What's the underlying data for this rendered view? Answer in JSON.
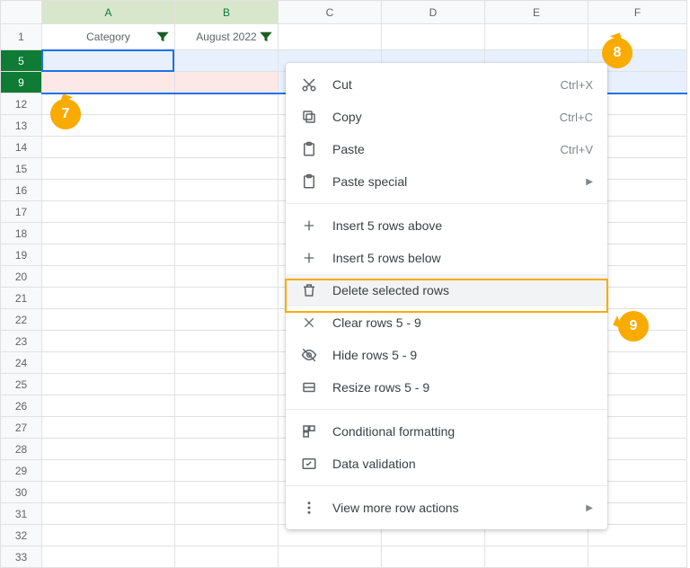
{
  "columns": [
    "A",
    "B",
    "C",
    "D",
    "E",
    "F"
  ],
  "row_headers": [
    "1",
    "5",
    "9",
    "12",
    "13",
    "14",
    "15",
    "16",
    "17",
    "18",
    "19",
    "20",
    "21",
    "22",
    "23",
    "24",
    "25",
    "26",
    "27",
    "28",
    "29",
    "30",
    "31",
    "32",
    "33"
  ],
  "selected_rows": [
    "5",
    "9"
  ],
  "selected_cols": [
    "A",
    "B"
  ],
  "header": {
    "a": "Category",
    "b": "August 2022"
  },
  "menu": {
    "cut": "Cut",
    "cut_sc": "Ctrl+X",
    "copy": "Copy",
    "copy_sc": "Ctrl+C",
    "paste": "Paste",
    "paste_sc": "Ctrl+V",
    "paste_special": "Paste special",
    "insert_above": "Insert 5 rows above",
    "insert_below": "Insert 5 rows below",
    "delete_sel": "Delete selected rows",
    "clear": "Clear rows 5 - 9",
    "hide": "Hide rows 5 - 9",
    "resize": "Resize rows 5 - 9",
    "cond_fmt": "Conditional formatting",
    "data_val": "Data validation",
    "more": "View more row actions"
  },
  "callouts": {
    "c7": "7",
    "c8": "8",
    "c9": "9"
  }
}
